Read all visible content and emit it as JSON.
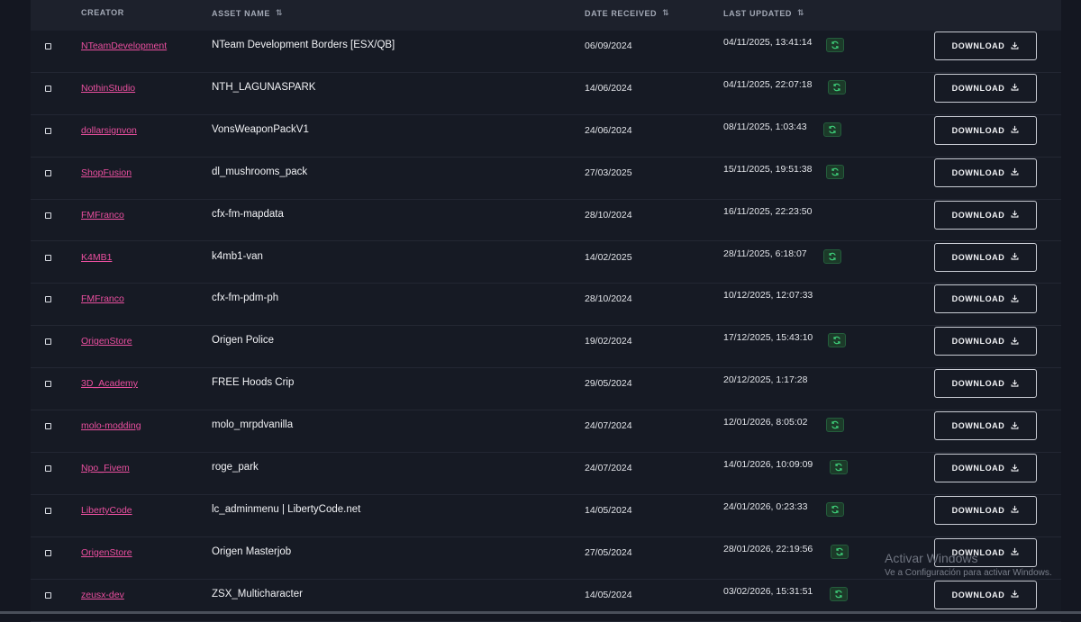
{
  "table": {
    "headers": {
      "creator": "CREATOR",
      "asset_name": "ASSET NAME",
      "date_received": "DATE RECEIVED",
      "last_updated": "LAST UPDATED",
      "sort_glyph": "⇅"
    },
    "download_label": "DOWNLOAD",
    "rows": [
      {
        "creator": "NTeamDevelopment",
        "asset": "NTeam Development Borders [ESX/QB]",
        "received": "06/09/2024",
        "updated": "04/11/2025, 13:41:14",
        "synced": true
      },
      {
        "creator": "NothinStudio",
        "asset": "NTH_LAGUNASPARK",
        "received": "14/06/2024",
        "updated": "04/11/2025, 22:07:18",
        "synced": true
      },
      {
        "creator": "dollarsignvon",
        "asset": "VonsWeaponPackV1",
        "received": "24/06/2024",
        "updated": "08/11/2025, 1:03:43",
        "synced": true
      },
      {
        "creator": "ShopFusion",
        "asset": "dl_mushrooms_pack",
        "received": "27/03/2025",
        "updated": "15/11/2025, 19:51:38",
        "synced": true
      },
      {
        "creator": "FMFranco",
        "asset": "cfx-fm-mapdata",
        "received": "28/10/2024",
        "updated": "16/11/2025, 22:23:50",
        "synced": false
      },
      {
        "creator": "K4MB1",
        "asset": "k4mb1-van",
        "received": "14/02/2025",
        "updated": "28/11/2025, 6:18:07",
        "synced": true
      },
      {
        "creator": "FMFranco",
        "asset": "cfx-fm-pdm-ph",
        "received": "28/10/2024",
        "updated": "10/12/2025, 12:07:33",
        "synced": false
      },
      {
        "creator": "OrigenStore",
        "asset": "Origen Police",
        "received": "19/02/2024",
        "updated": "17/12/2025, 15:43:10",
        "synced": true
      },
      {
        "creator": "3D_Academy",
        "asset": "FREE Hoods Crip",
        "received": "29/05/2024",
        "updated": "20/12/2025, 1:17:28",
        "synced": false
      },
      {
        "creator": "molo-modding",
        "asset": "molo_mrpdvanilla",
        "received": "24/07/2024",
        "updated": "12/01/2026, 8:05:02",
        "synced": true
      },
      {
        "creator": "Npo_Fivem",
        "asset": "roge_park",
        "received": "24/07/2024",
        "updated": "14/01/2026, 10:09:09",
        "synced": true
      },
      {
        "creator": "LibertyCode",
        "asset": "lc_adminmenu | LibertyCode.net",
        "received": "14/05/2024",
        "updated": "24/01/2026, 0:23:33",
        "synced": true
      },
      {
        "creator": "OrigenStore",
        "asset": "Origen Masterjob",
        "received": "27/05/2024",
        "updated": "28/01/2026, 22:19:56",
        "synced": true
      },
      {
        "creator": "zeusx-dev",
        "asset": "ZSX_Multicharacter",
        "received": "14/05/2024",
        "updated": "03/02/2026, 15:31:51",
        "synced": true
      }
    ]
  },
  "watermark": {
    "line1": "Activar Windows",
    "line2": "Ve a Configuración para activar Windows."
  },
  "colors": {
    "background": "#161a24",
    "header_bg": "#1d212c",
    "creator_link": "#ea4f9f",
    "sync_badge": "#1c3a29",
    "sync_icon": "#3ecf7a"
  },
  "icons": {
    "sort": "sort-arrows-icon",
    "sync": "sync-icon",
    "download": "download-icon"
  }
}
